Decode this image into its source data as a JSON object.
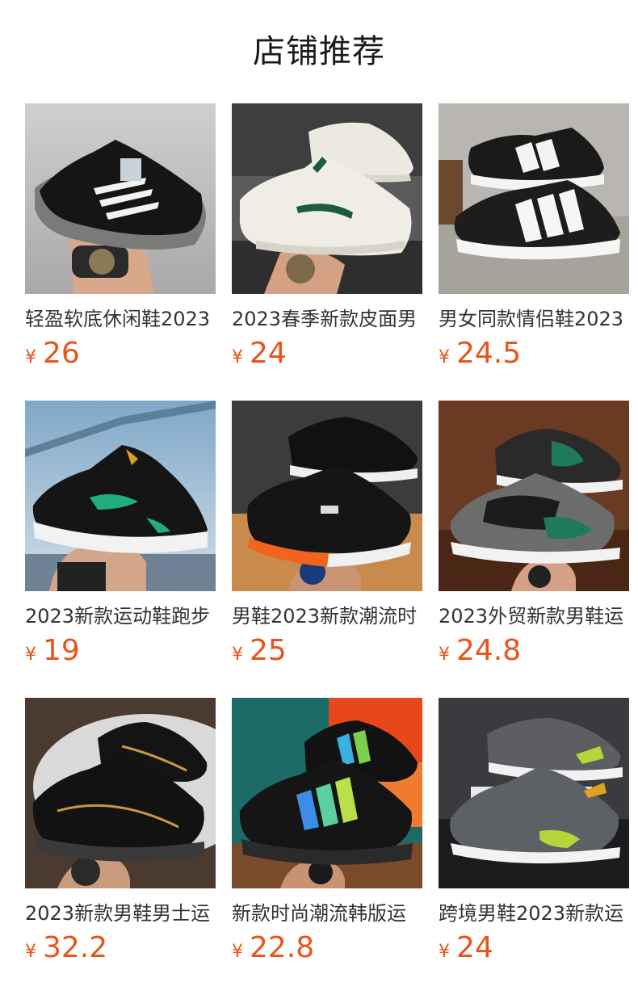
{
  "header": {
    "title": "店铺推荐"
  },
  "colors": {
    "price": "#e8541a"
  },
  "products": [
    {
      "name": "轻盈软底休闲鞋2023",
      "currency": "¥",
      "price": "26",
      "image": "black-white-stripe-running-shoe"
    },
    {
      "name": "2023春季新款皮面男",
      "currency": "¥",
      "price": "24",
      "image": "white-green-leather-sneaker"
    },
    {
      "name": "男女同款情侣鞋2023",
      "currency": "¥",
      "price": "24.5",
      "image": "black-white-stripe-couple-sneaker"
    },
    {
      "name": "2023新款运动鞋跑步",
      "currency": "¥",
      "price": "19",
      "image": "black-green-running-shoe"
    },
    {
      "name": "男鞋2023新款潮流时",
      "currency": "¥",
      "price": "25",
      "image": "black-orange-chunky-sneaker"
    },
    {
      "name": "2023外贸新款男鞋运",
      "currency": "¥",
      "price": "24.8",
      "image": "grey-green-chunky-sneaker"
    },
    {
      "name": "2023新款男鞋男士运",
      "currency": "¥",
      "price": "32.2",
      "image": "black-gold-air-sneaker"
    },
    {
      "name": "新款时尚潮流韩版运",
      "currency": "¥",
      "price": "22.8",
      "image": "black-iridescent-stripe-sneaker"
    },
    {
      "name": "跨境男鞋2023新款运",
      "currency": "¥",
      "price": "24",
      "image": "grey-lime-air-sneaker"
    }
  ]
}
